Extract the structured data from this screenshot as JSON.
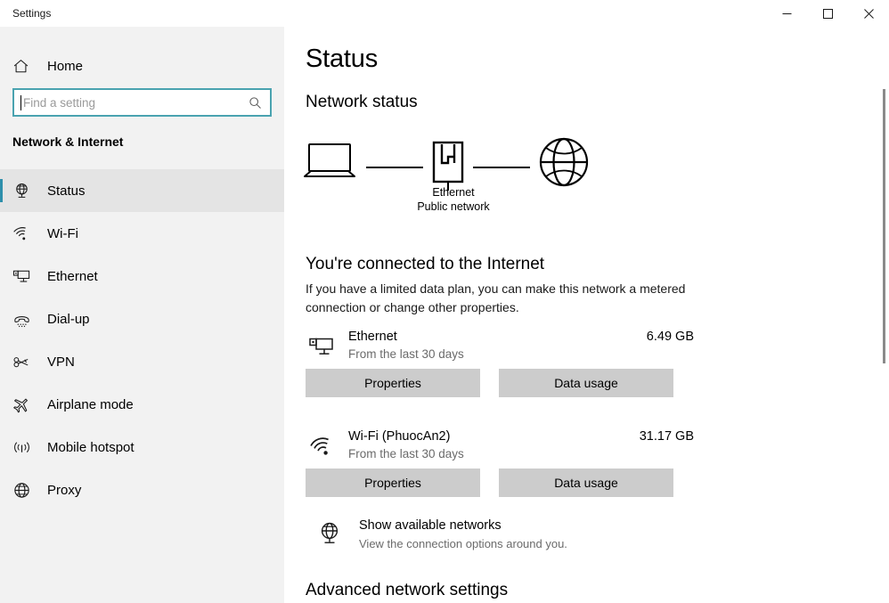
{
  "window": {
    "title": "Settings",
    "controls": {
      "minimize": "Minimize",
      "maximize": "Maximize",
      "close": "Close"
    }
  },
  "sidebar": {
    "home_label": "Home",
    "home_icon": "home-icon",
    "search": {
      "placeholder": "Find a setting",
      "value": "",
      "icon": "search-icon"
    },
    "section_title": "Network & Internet",
    "accent_color": "#2e8fab",
    "focus_border_color": "#4aa3b0",
    "background_color": "#f2f2f2",
    "items": [
      {
        "label": "Status",
        "icon": "status-globe-monitor-icon",
        "selected": true
      },
      {
        "label": "Wi-Fi",
        "icon": "wifi-icon",
        "selected": false
      },
      {
        "label": "Ethernet",
        "icon": "ethernet-monitor-icon",
        "selected": false
      },
      {
        "label": "Dial-up",
        "icon": "dialup-phone-icon",
        "selected": false
      },
      {
        "label": "VPN",
        "icon": "vpn-key-icon",
        "selected": false
      },
      {
        "label": "Airplane mode",
        "icon": "airplane-icon",
        "selected": false
      },
      {
        "label": "Mobile hotspot",
        "icon": "hotspot-signal-icon",
        "selected": false
      },
      {
        "label": "Proxy",
        "icon": "globe-icon",
        "selected": false
      }
    ]
  },
  "main": {
    "page_title": "Status",
    "network_status_heading": "Network status",
    "diagram": {
      "device_icon": "laptop-icon",
      "adapter_icon": "ethernet-port-icon",
      "internet_icon": "globe-icon",
      "caption_line1": "Ethernet",
      "caption_line2": "Public network"
    },
    "connected_heading": "You're connected to the Internet",
    "connected_description": "If you have a limited data plan, you can make this network a metered connection or change other properties.",
    "connections": [
      {
        "name": "Ethernet",
        "icon": "ethernet-monitor-icon",
        "period": "From the last 30 days",
        "usage": "6.49 GB",
        "properties_label": "Properties",
        "data_usage_label": "Data usage"
      },
      {
        "name": "Wi-Fi (PhuocAn2)",
        "icon": "wifi-icon",
        "period": "From the last 30 days",
        "usage": "31.17 GB",
        "properties_label": "Properties",
        "data_usage_label": "Data usage"
      }
    ],
    "show_networks": {
      "icon": "globe-monitor-icon",
      "title": "Show available networks",
      "subtitle": "View the connection options around you."
    },
    "advanced_heading": "Advanced network settings"
  }
}
